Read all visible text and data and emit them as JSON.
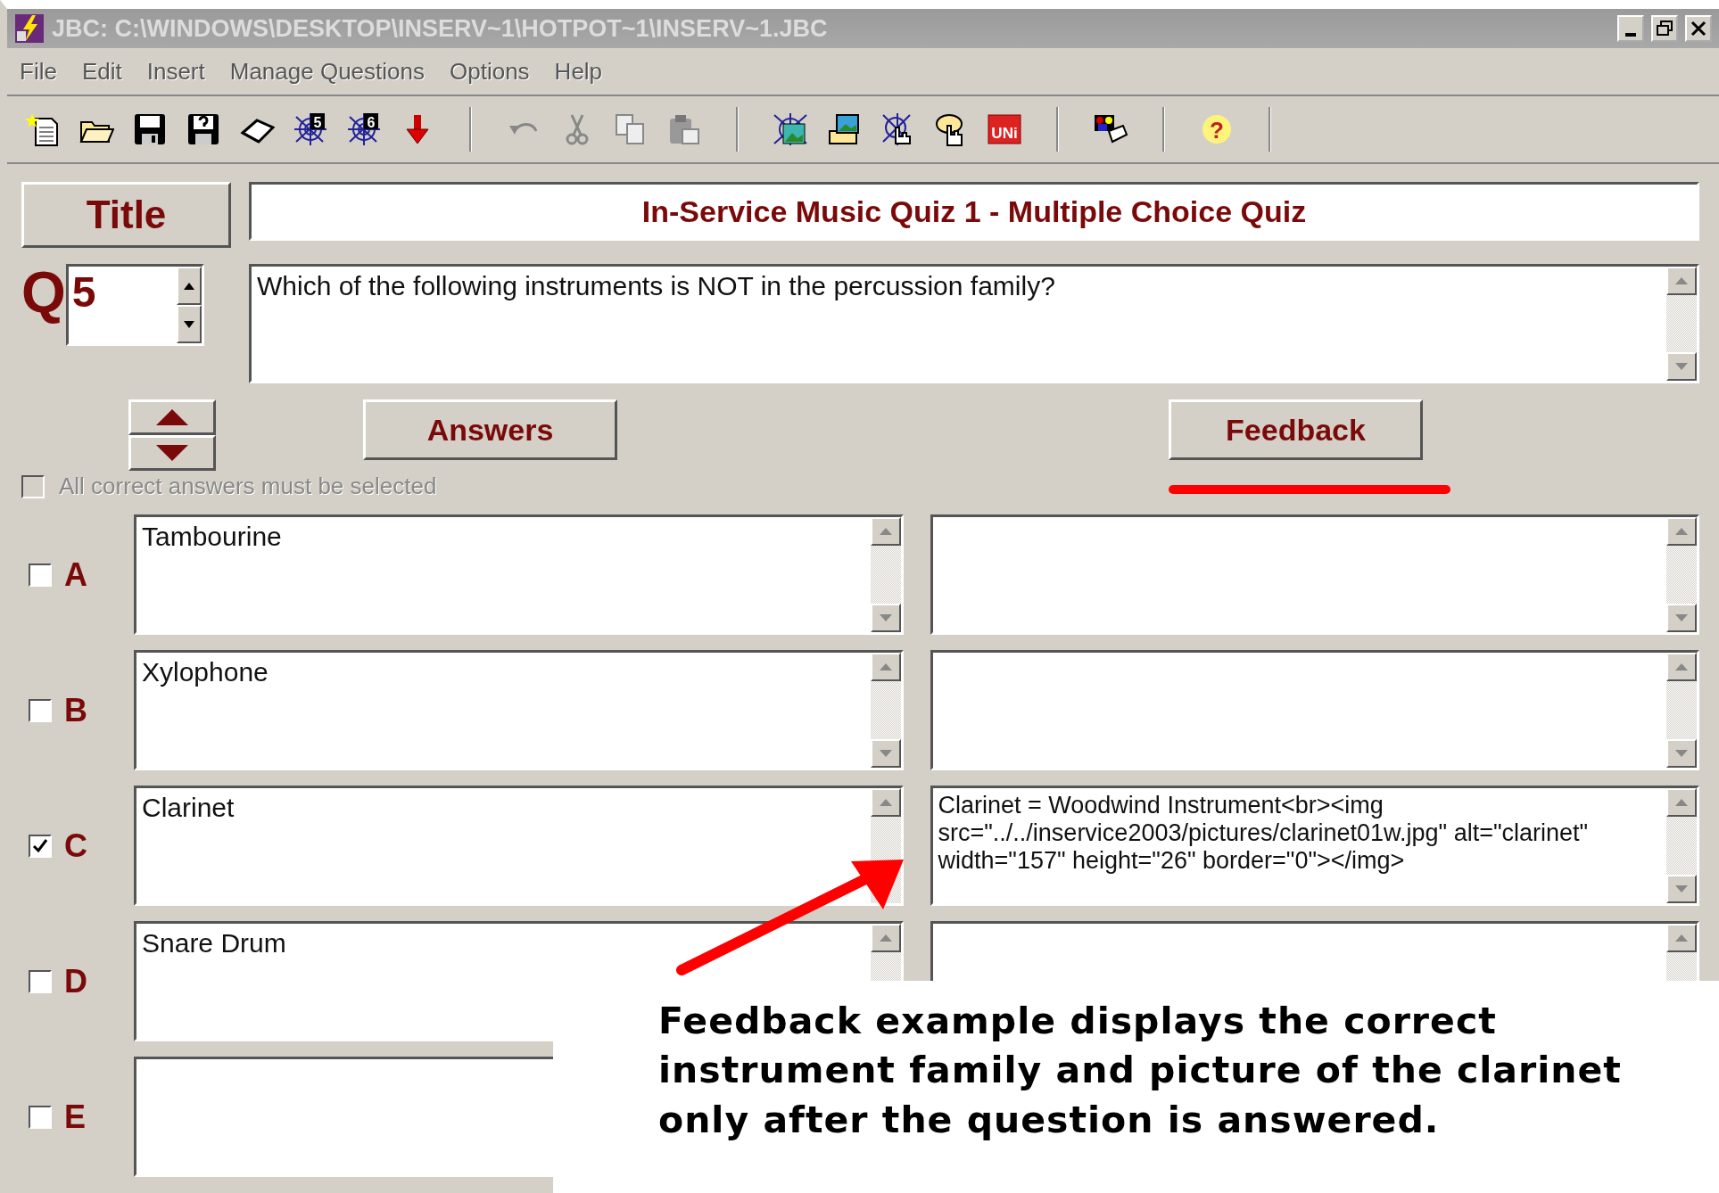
{
  "window": {
    "title": "JBC: C:\\WINDOWS\\DESKTOP\\INSERV~1\\HOTPOT~1\\INSERV~1.JBC"
  },
  "menu": [
    "File",
    "Edit",
    "Insert",
    "Manage Questions",
    "Options",
    "Help"
  ],
  "toolbar": [
    {
      "kind": "new"
    },
    {
      "kind": "open"
    },
    {
      "kind": "save"
    },
    {
      "kind": "saveas"
    },
    {
      "kind": "eraser"
    },
    {
      "kind": "web",
      "text": "5"
    },
    {
      "kind": "web",
      "text": "6"
    },
    {
      "kind": "down"
    },
    {
      "kind": "sep"
    },
    {
      "kind": "undo"
    },
    {
      "kind": "cut"
    },
    {
      "kind": "copy"
    },
    {
      "kind": "paste"
    },
    {
      "kind": "sep"
    },
    {
      "kind": "webimage"
    },
    {
      "kind": "imagefolder"
    },
    {
      "kind": "webhand"
    },
    {
      "kind": "hand"
    },
    {
      "kind": "tile",
      "text": "UNi"
    },
    {
      "kind": "sep"
    },
    {
      "kind": "pictures"
    },
    {
      "kind": "sep"
    },
    {
      "kind": "help",
      "text": "?"
    },
    {
      "kind": "sep"
    }
  ],
  "title_button": "Title",
  "quiz_title": "In-Service Music Quiz 1 - Multiple Choice Quiz",
  "question": {
    "label": "Q",
    "number": "5",
    "text": "Which of the following instruments is NOT in the percussion family?"
  },
  "answers_button": "Answers",
  "feedback_button": "Feedback",
  "all_correct": {
    "label": "All correct answers must be selected",
    "checked": false,
    "disabled": true
  },
  "answers": [
    {
      "letter": "A",
      "checked": false,
      "text": "Tambourine",
      "feedback_field": true
    },
    {
      "letter": "B",
      "checked": false,
      "text": "Xylophone",
      "feedback_field": true
    },
    {
      "letter": "C",
      "checked": true,
      "text": "Clarinet",
      "feedback_field": true,
      "feedback": "Clarinet = Woodwind Instrument<br><img src=\"../../inservice2003/pictures/clarinet01w.jpg\" alt=\"clarinet\" width=\"157\" height=\"26\" border=\"0\"></img>"
    },
    {
      "letter": "D",
      "checked": false,
      "text": "Snare Drum",
      "feedback_field": true
    },
    {
      "letter": "E",
      "checked": false,
      "feedback_field": false
    }
  ],
  "note": "Feedback example displays the correct instrument family and picture of the clarinet only after the question is answered."
}
